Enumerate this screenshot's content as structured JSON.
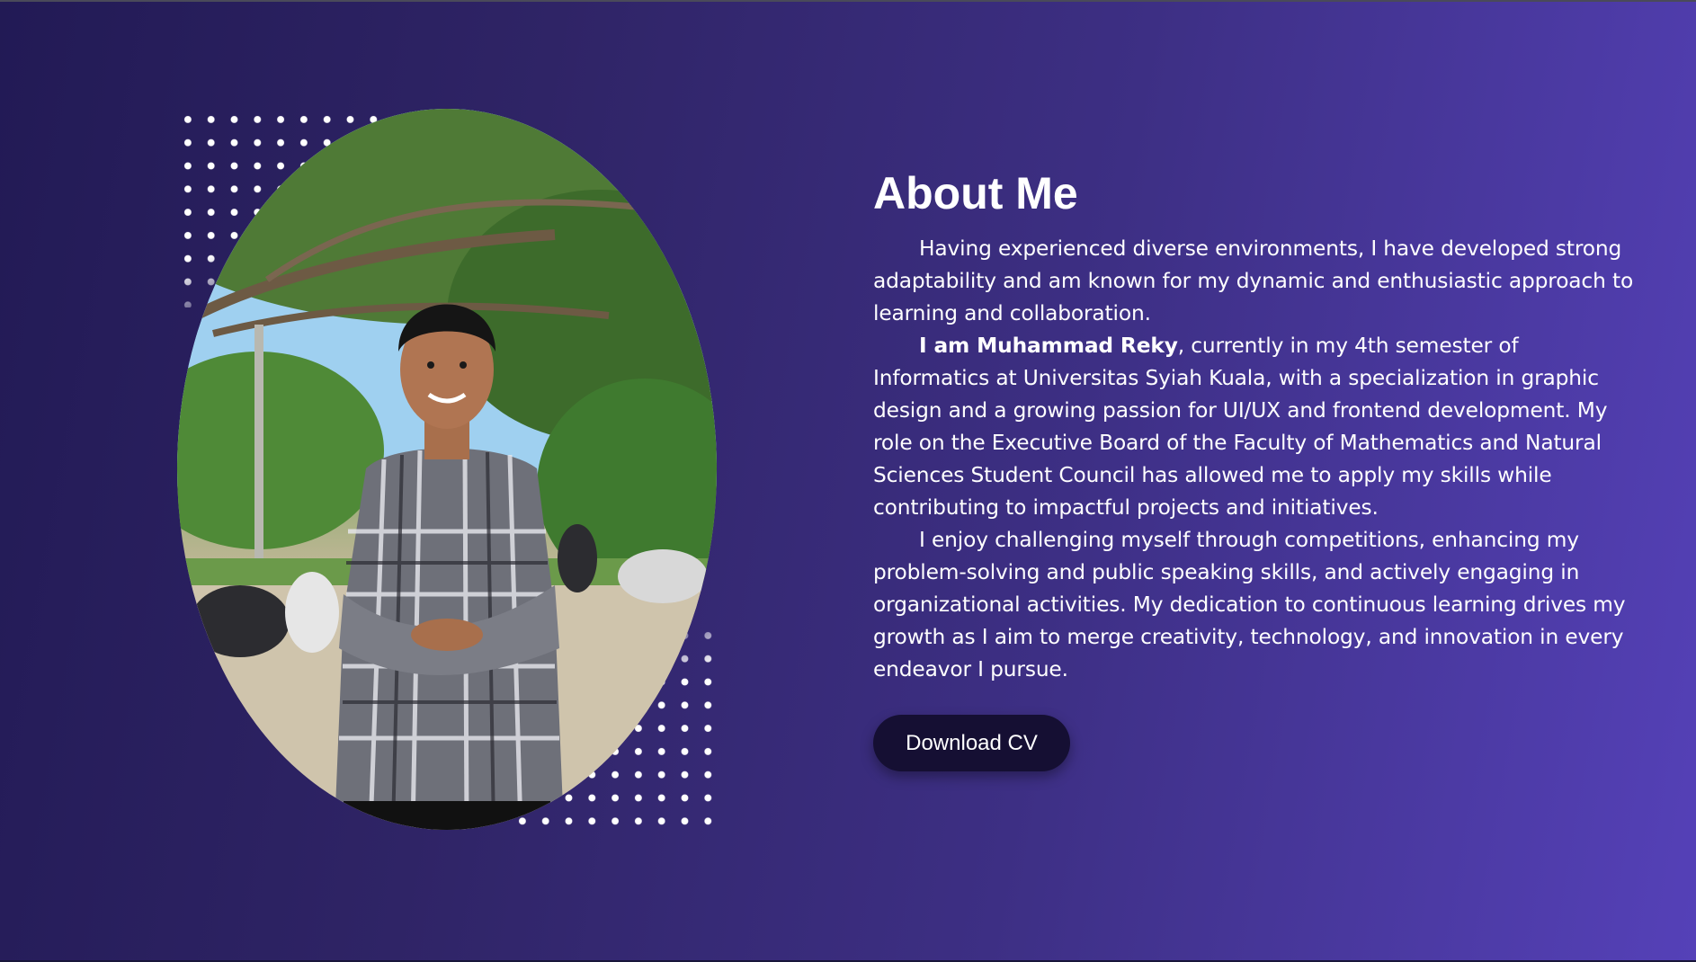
{
  "about": {
    "title": "About Me",
    "paragraph_1": "Having experienced diverse environments, I have developed strong adaptability and am known for my dynamic and enthusiastic approach to learning and collaboration.",
    "paragraph_2_bold": "I am Muhammad Reky",
    "paragraph_2_rest": ", currently in my 4th semester of Informatics at Universitas Syiah Kuala, with a specialization in graphic design and a growing passion for UI/UX and frontend development. My role on the Executive Board of the Faculty of Mathematics and Natural Sciences Student Council has allowed me to apply my skills while contributing to impactful projects and initiatives.",
    "paragraph_3": "I enjoy challenging myself through competitions, enhancing my problem-solving and public speaking skills, and actively engaging in organizational activities. My dedication to continuous learning drives my growth as I aim to merge creativity, technology, and innovation in every endeavor I pursue.",
    "download_label": "Download CV"
  },
  "photo": {
    "icon": "profile-photo"
  },
  "colors": {
    "background_start": "#221a55",
    "background_end": "#5541b8",
    "button_bg": "#150f33",
    "text": "#ffffff"
  }
}
